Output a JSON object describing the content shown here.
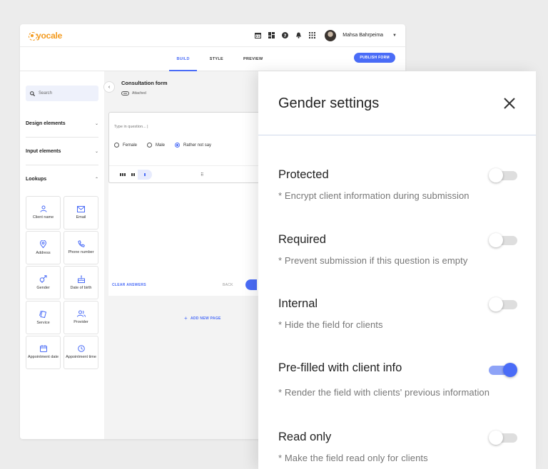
{
  "app": {
    "logo_text": "yocale",
    "user_name": "Mahsa Bahrpeima"
  },
  "tabs": [
    {
      "label": "BUILD",
      "active": true
    },
    {
      "label": "STYLE",
      "active": false
    },
    {
      "label": "PREVIEW",
      "active": false
    }
  ],
  "publish_label": "PUBLISH FORM",
  "sidebar": {
    "search_placeholder": "Search",
    "sections": [
      "Design elements",
      "Input elements",
      "Lookups"
    ],
    "lookups": [
      {
        "label": "Client name",
        "icon": "person-icon"
      },
      {
        "label": "Email",
        "icon": "mail-icon"
      },
      {
        "label": "Address",
        "icon": "location-pin-icon"
      },
      {
        "label": "Phone number",
        "icon": "phone-icon"
      },
      {
        "label": "Gender",
        "icon": "gender-icon"
      },
      {
        "label": "Date of birth",
        "icon": "cake-icon"
      },
      {
        "label": "Service",
        "icon": "service-tag-icon"
      },
      {
        "label": "Provider",
        "icon": "people-icon"
      },
      {
        "label": "Appointment date",
        "icon": "calendar-icon"
      },
      {
        "label": "Appointment time",
        "icon": "clock-icon"
      }
    ]
  },
  "form": {
    "title": "Consultation form",
    "attachment_label": "Attached",
    "question_placeholder": "Type in question... |",
    "options": [
      {
        "label": "Female",
        "selected": false
      },
      {
        "label": "Male",
        "selected": false
      },
      {
        "label": "Rather not say",
        "selected": true
      }
    ],
    "clear_label": "CLEAR ANSWERS",
    "back_label": "BACK",
    "add_page_label": "ADD NEW PAGE"
  },
  "panel": {
    "title": "Gender settings",
    "settings": [
      {
        "label": "Protected",
        "desc": "* Encrypt client information during submission",
        "on": false
      },
      {
        "label": "Required",
        "desc": "* Prevent submission if this question is empty",
        "on": false
      },
      {
        "label": "Internal",
        "desc": "* Hide the field for clients",
        "on": false
      },
      {
        "label": "Pre-filled with client info",
        "desc": "* Render the field with clients' previous information",
        "on": true
      },
      {
        "label": "Read only",
        "desc": "* Make the field read only for clients",
        "on": false
      }
    ]
  },
  "colors": {
    "accent": "#4a6cf7",
    "logo": "#f39a1e",
    "toggle_off": "#dedede"
  }
}
